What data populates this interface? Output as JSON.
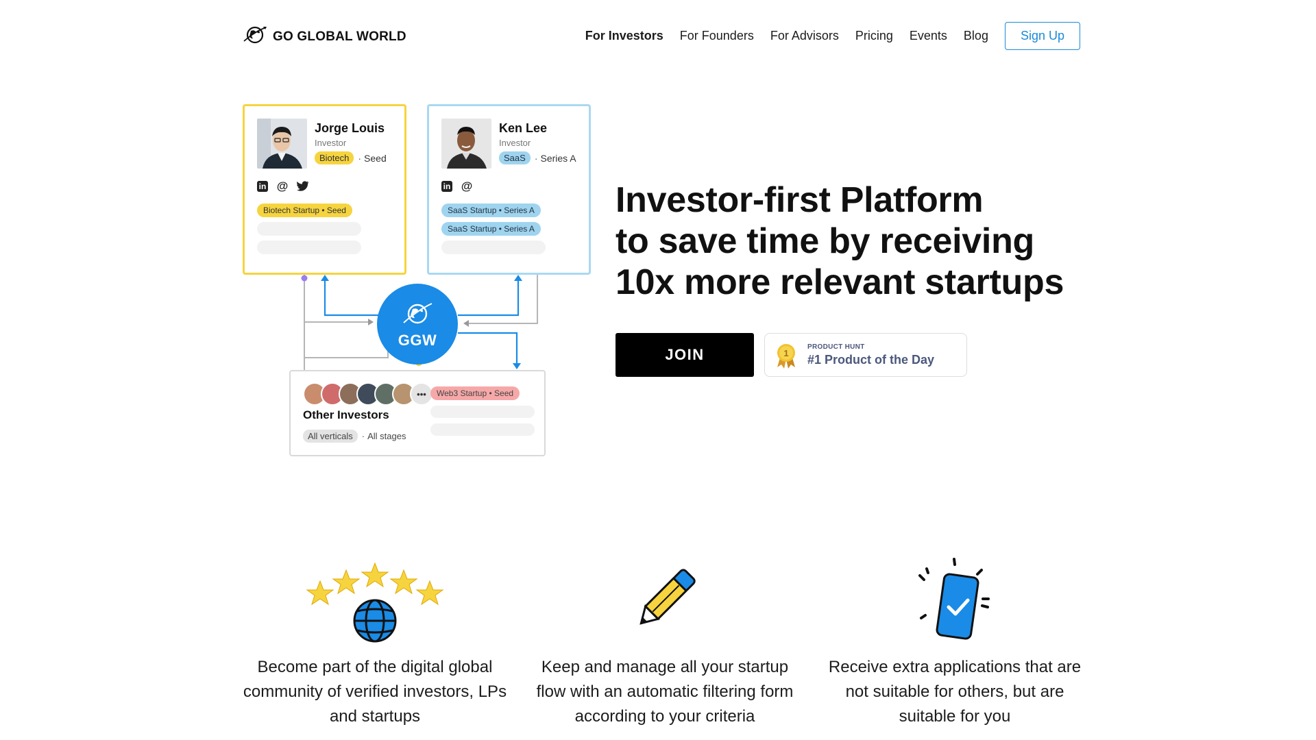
{
  "brand": {
    "name": "GO GLOBAL WORLD",
    "logo_icon": "globe-orbit-icon"
  },
  "nav": {
    "items": [
      "For Investors",
      "For Founders",
      "For Advisors",
      "Pricing",
      "Events",
      "Blog"
    ],
    "active": "For Investors",
    "signup_label": "Sign Up"
  },
  "illustration": {
    "jorge": {
      "name": "Jorge Louis",
      "role": "Investor",
      "vertical": "Biotech",
      "stage": "Seed",
      "deals": [
        "Biotech Startup • Seed"
      ]
    },
    "ken": {
      "name": "Ken Lee",
      "role": "Investor",
      "vertical": "SaaS",
      "stage": "Series A",
      "deals": [
        "SaaS Startup • Series A",
        "SaaS Startup • Series A"
      ]
    },
    "hub_label": "GGW",
    "other": {
      "title": "Other Investors",
      "verticals": "All verticals",
      "stages": "All stages",
      "more": "•••",
      "deal": "Web3 Startup • Seed"
    }
  },
  "hero": {
    "title_lines": [
      "Investor-first Platform",
      "to save time by receiving",
      "10x more relevant startups"
    ],
    "join_label": "JOIN",
    "product_hunt": {
      "kicker": "PRODUCT HUNT",
      "title": "#1 Product of the Day",
      "medal_number": "1"
    }
  },
  "features": [
    {
      "icon": "stars-globe-icon",
      "text": "Become part of the digital global community of verified investors, LPs and startups"
    },
    {
      "icon": "pencil-icon",
      "text": "Keep and manage all your startup flow with an automatic filtering form according to your criteria"
    },
    {
      "icon": "phone-check-icon",
      "text": "Receive extra applications that are not suitable for others, but are suitable for you"
    }
  ],
  "colors": {
    "accent_blue": "#1a8be6",
    "brand_yellow": "#f6d43f",
    "light_blue": "#a9d8f2",
    "signup": "#1a8bd6"
  }
}
